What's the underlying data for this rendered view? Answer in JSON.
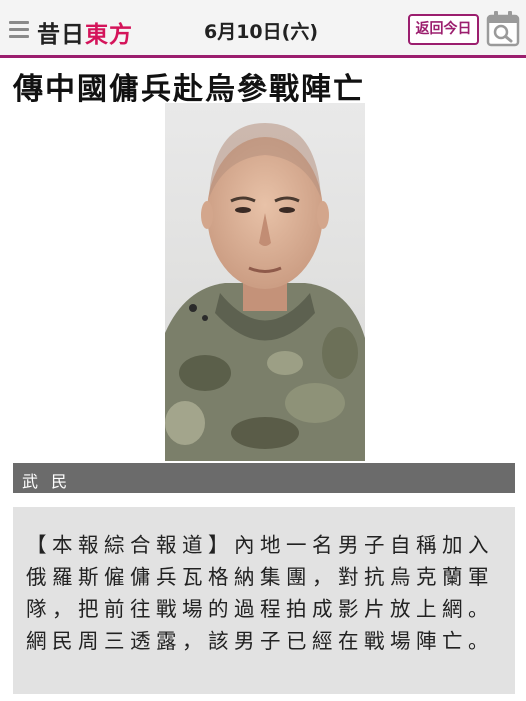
{
  "header": {
    "brand_part1": "昔日",
    "brand_part2": "東方",
    "date": "6月10日(六)",
    "today_button_label": "返回今日",
    "menu_icon": "hamburger-menu-icon",
    "calendar_icon": "calendar-search-icon",
    "accent_color": "#9b1e6e",
    "brand_color": "#d4145a"
  },
  "article": {
    "headline": "傳中國傭兵赴烏參戰陣亡",
    "photo_caption": "武 民",
    "body": "【本報綜合報道】內地一名男子自稱加入俄羅斯僱傭兵瓦格納集團，對抗烏克蘭軍隊，把前往戰場的過程拍成影片放上網。網民周三透露，該男子已經在戰場陣亡。"
  }
}
